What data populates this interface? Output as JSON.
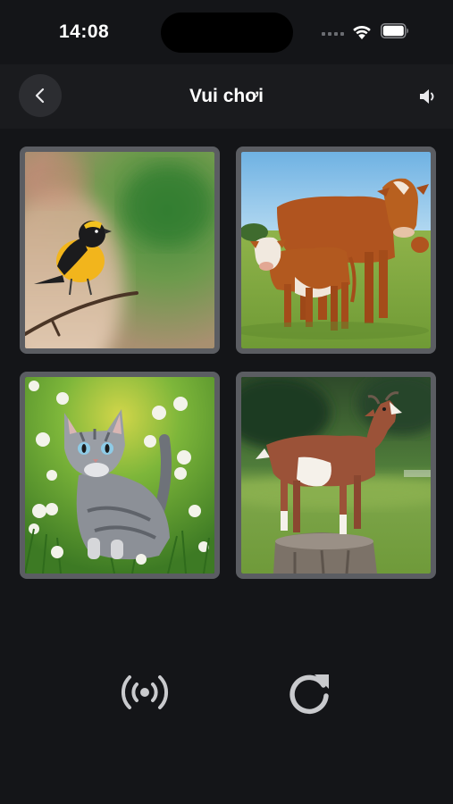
{
  "status_bar": {
    "time": "14:08"
  },
  "header": {
    "title": "Vui chơi"
  },
  "icons": {
    "back": "chevron-left-icon",
    "sound": "speaker-icon",
    "listen": "broadcast-icon",
    "replay": "refresh-icon"
  },
  "cards": [
    {
      "animal": "bird"
    },
    {
      "animal": "cow"
    },
    {
      "animal": "cat"
    },
    {
      "animal": "goat"
    }
  ],
  "colors": {
    "background": "#141518",
    "card_border": "#5b5d62",
    "icon": "#c9cacd"
  }
}
